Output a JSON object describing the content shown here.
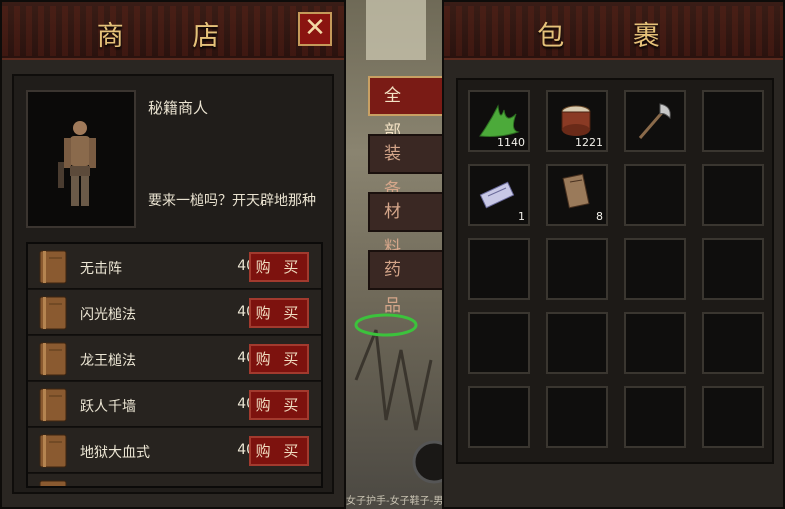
{
  "shop": {
    "title": "商 店",
    "close_label": "✕",
    "npc": {
      "name": "秘籍商人",
      "dialog": "要来一槌吗？开天辟地那种"
    },
    "items": [
      {
        "name": "无击阵",
        "price": "400",
        "buy": "购 买"
      },
      {
        "name": "闪光槌法",
        "price": "400",
        "buy": "购 买"
      },
      {
        "name": "龙王槌法",
        "price": "400",
        "buy": "购 买"
      },
      {
        "name": "跃人千墙",
        "price": "400",
        "buy": "购 买"
      },
      {
        "name": "地狱大血式",
        "price": "400",
        "buy": "购 买"
      }
    ]
  },
  "tabs": [
    "全 部",
    "装 备",
    "材 料",
    "药 品"
  ],
  "scene": {
    "bottom_text": "女子护手-女子鞋子-男"
  },
  "bag": {
    "title": "包 裹",
    "slots": [
      {
        "icon": "herb-icon",
        "count": "1140"
      },
      {
        "icon": "drum-icon",
        "count": "1221"
      },
      {
        "icon": "axe-icon",
        "count": ""
      },
      {
        "icon": "",
        "count": ""
      },
      {
        "icon": "scroll-icon",
        "count": "1"
      },
      {
        "icon": "book-icon",
        "count": "8"
      }
    ]
  },
  "colors": {
    "accent_red": "#7d120e",
    "gold": "#e6c27a"
  }
}
